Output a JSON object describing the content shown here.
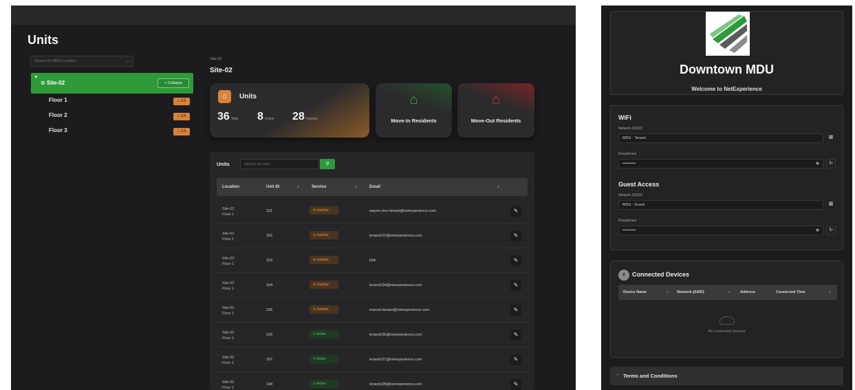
{
  "units_app": {
    "page_title": "Units",
    "tree_search_placeholder": "Search for MDU location...",
    "site": {
      "name": "Site-02",
      "collapse_label": "Collapse"
    },
    "floors": [
      {
        "name": "Floor 1",
        "count": "13"
      },
      {
        "name": "Floor 2",
        "count": "13"
      },
      {
        "name": "Floor 3",
        "count": "13"
      }
    ],
    "breadcrumb": "Site-02",
    "content_title": "Site-02",
    "units_card": {
      "title": "Units",
      "total": "36",
      "total_label": "Total",
      "active": "8",
      "active_label": "Active",
      "inactive": "28",
      "inactive_label": "Inactive"
    },
    "move_in_label": "Move-In Residents",
    "move_out_label": "Move-Out Residents",
    "table": {
      "title": "Units",
      "search_placeholder": "Search for unit...",
      "headers": [
        "Location",
        "Unit ID",
        "Service",
        "Email"
      ],
      "rows": [
        {
          "loc1": "Site-02",
          "loc2": "Floor 1",
          "unit": "101",
          "service": "Inactive",
          "email": "wayne.chu+tenant@netexperience.com"
        },
        {
          "loc1": "Site-02",
          "loc2": "Floor 1",
          "unit": "102",
          "service": "Inactive",
          "email": "tenant102@netexperience.com"
        },
        {
          "loc1": "Site-02",
          "loc2": "Floor 1",
          "unit": "103",
          "service": "Inactive",
          "email": "N/A"
        },
        {
          "loc1": "Site-02",
          "loc2": "Floor 1",
          "unit": "104",
          "service": "Inactive",
          "email": "tenant104@netexperience.com"
        },
        {
          "loc1": "Site-02",
          "loc2": "Floor 1",
          "unit": "105",
          "service": "Inactive",
          "email": "marcel+tenant@netexperience.com"
        },
        {
          "loc1": "Site-02",
          "loc2": "Floor 1",
          "unit": "106",
          "service": "Active",
          "email": "tenant106@netexperience.com"
        },
        {
          "loc1": "Site-02",
          "loc2": "Floor 1",
          "unit": "107",
          "service": "Active",
          "email": "tenant107@netexperience.com"
        },
        {
          "loc1": "Site-02",
          "loc2": "Floor 1",
          "unit": "108",
          "service": "Active",
          "email": "tenant108@netexperience.com"
        }
      ]
    }
  },
  "portal": {
    "title": "Downtown MDU",
    "subtitle": "Welcome to NetExperience",
    "wifi": {
      "title": "WiFi",
      "network_label": "Network (SSID)",
      "network_value": "MDU - Tenant",
      "pass_label": "Passphrase",
      "pass_value": "••••••••••"
    },
    "guest": {
      "title": "Guest Access",
      "network_label": "Network (SSID)",
      "network_value": "MDU - Guest",
      "pass_label": "Passphrase",
      "pass_value": "••••••••••"
    },
    "devices": {
      "badge": "0",
      "title": "Connected Devices",
      "headers": [
        "Device Name",
        "Network (SSID)",
        "Address",
        "Connected Time"
      ],
      "empty_text": "No connected devices"
    },
    "terms_label": "Terms and Conditions"
  },
  "colors": {
    "accent_green": "#2f9a3a",
    "accent_orange": "#d9833a",
    "accent_red": "#c23a3c",
    "background": "#1c1c1e"
  }
}
